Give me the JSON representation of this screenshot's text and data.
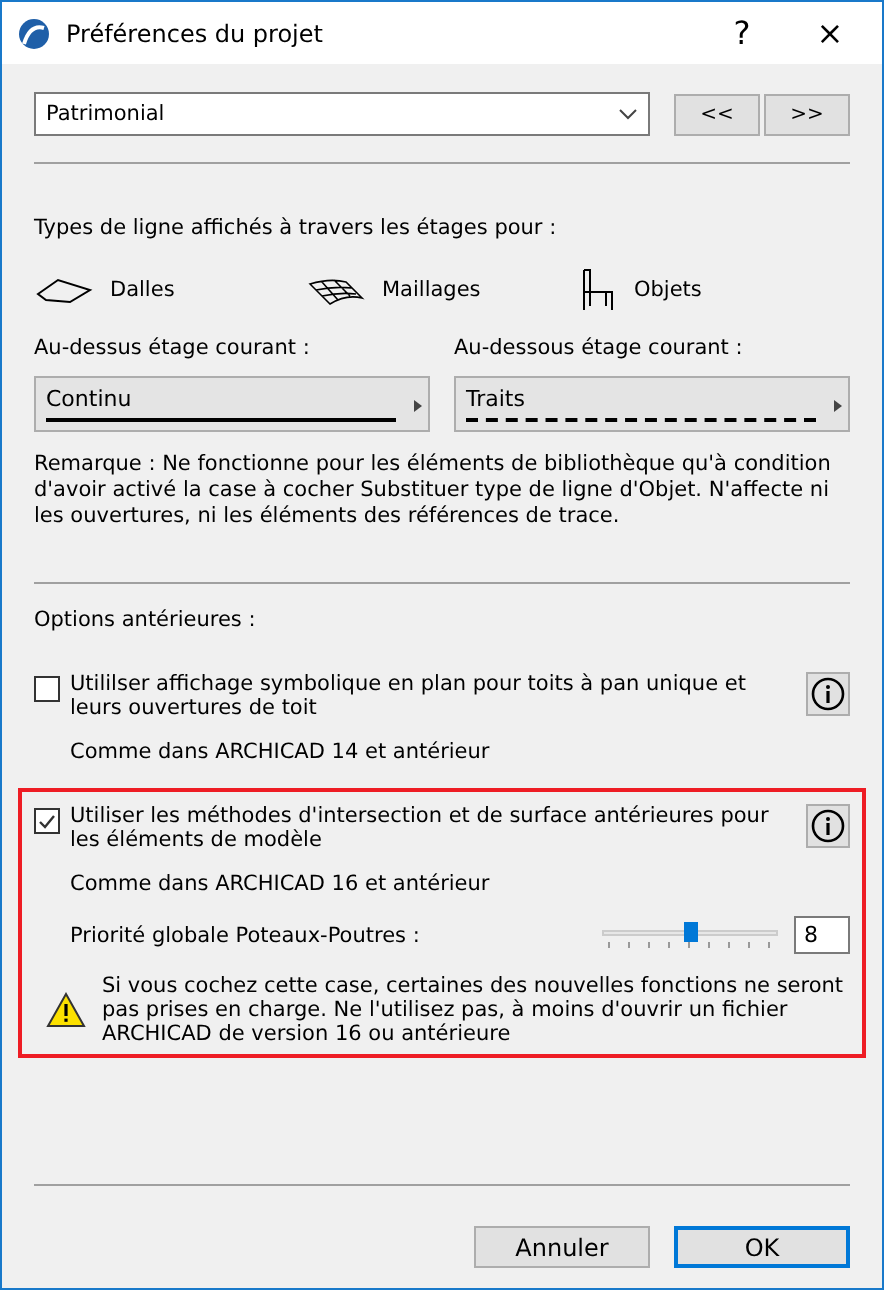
{
  "window": {
    "title": "Préférences du projet",
    "help": "?",
    "close": "×"
  },
  "preset": {
    "value": "Patrimonial",
    "prev": "<<",
    "next": ">>"
  },
  "line_types": {
    "heading": "Types de ligne affichés à travers les étages pour :",
    "items": [
      {
        "kind": "slab",
        "label": "Dalles"
      },
      {
        "kind": "mesh",
        "label": "Maillages"
      },
      {
        "kind": "object",
        "label": "Objets"
      }
    ]
  },
  "above": {
    "label": "Au-dessus étage courant :",
    "value": "Continu",
    "kind": "solid"
  },
  "below": {
    "label": "Au-dessous étage courant :",
    "value": "Traits",
    "kind": "dashed"
  },
  "note": "Remarque : Ne fonctionne pour les éléments de bibliothèque qu'à condition d'avoir activé la case à cocher Substituer type de ligne d'Objet. N'affecte ni les ouvertures, ni les éléments des références de trace.",
  "legacy": {
    "heading": "Options antérieures :",
    "options": [
      {
        "label": "Utililser affichage symbolique en plan pour toits à pan unique et leurs ouvertures de toit",
        "checked": false,
        "highlighted": false,
        "subtitle": "Comme dans ARCHICAD 14 et antérieur"
      },
      {
        "label": "Utiliser les méthodes d'intersection et de surface antérieures pour les éléments de modèle",
        "checked": true,
        "highlighted": true,
        "subtitle": "Comme dans ARCHICAD 16 et antérieur",
        "priority": {
          "label": "Priorité globale Poteaux-Poutres :",
          "level": 0.5,
          "value": "8"
        },
        "warning": "Si vous cochez cette case, certaines des nouvelles fonctions ne seront pas prises en charge. Ne l'utilisez pas, à moins d'ouvrir un fichier ARCHICAD de version 16 ou antérieure"
      }
    ]
  },
  "buttons": [
    {
      "label": "Annuler",
      "default": false
    },
    {
      "label": "OK",
      "default": true
    }
  ]
}
